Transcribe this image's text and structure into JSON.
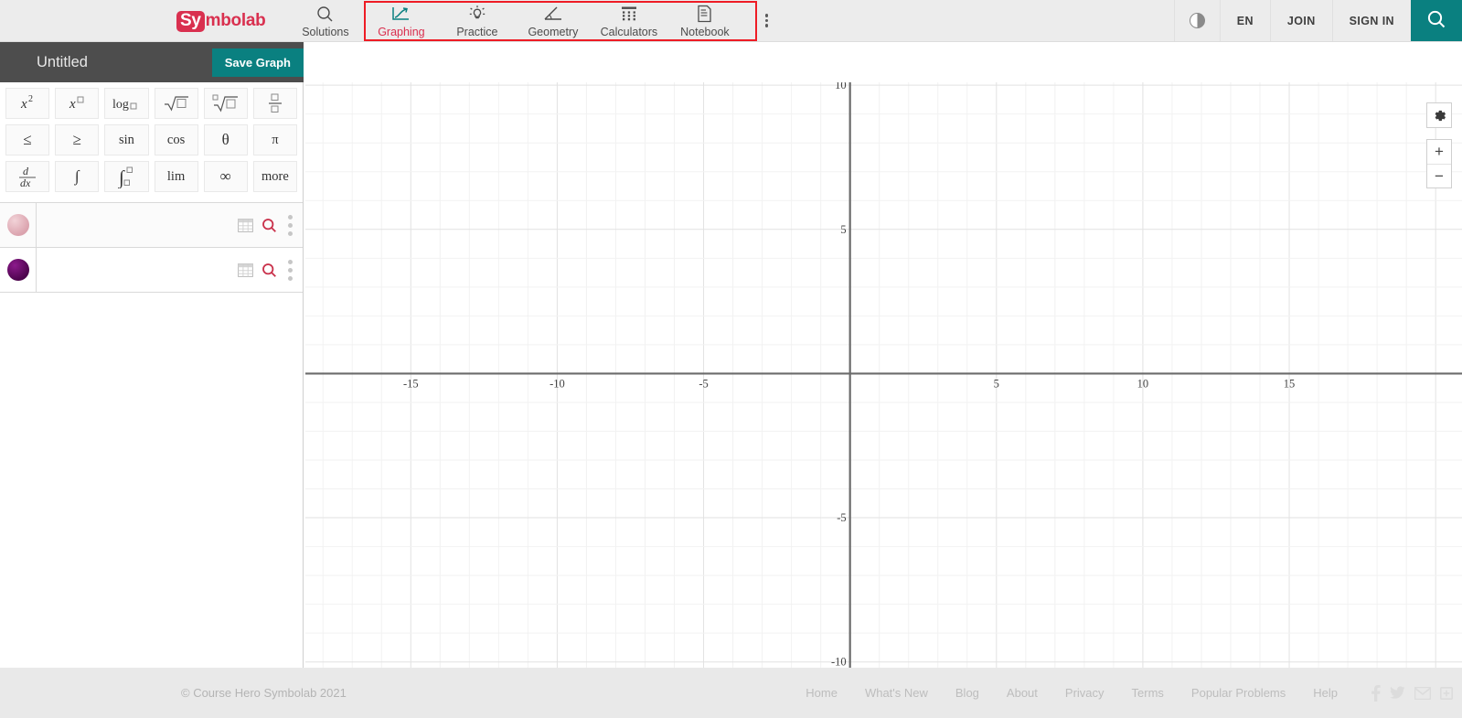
{
  "header": {
    "logo": {
      "badge": "Sy",
      "rest": "mbolab"
    },
    "nav": [
      {
        "label": "Solutions",
        "icon": "search-icon",
        "active": false
      },
      {
        "label": "Graphing",
        "icon": "graph-line-icon",
        "active": true
      },
      {
        "label": "Practice",
        "icon": "lightbulb-icon",
        "active": false
      },
      {
        "label": "Geometry",
        "icon": "angle-icon",
        "active": false
      },
      {
        "label": "Calculators",
        "icon": "grid-dots-icon",
        "active": false
      },
      {
        "label": "Notebook",
        "icon": "notebook-icon",
        "active": false
      }
    ],
    "overflow_icon": "vertical-dots-icon",
    "contrast_icon": "contrast-toggle-icon",
    "language": "EN",
    "join": "JOIN",
    "sign_in": "SIGN IN",
    "search_icon": "search-icon",
    "accent_teal": "#0a8080",
    "accent_red": "#d9304f",
    "highlight_box_color": "#ee1c25"
  },
  "titlebar": {
    "menu_icon": "vertical-dots-icon",
    "graph_name": "Untitled",
    "save_label": "Save Graph"
  },
  "keypad": [
    {
      "name": "x-squared",
      "type": "svg"
    },
    {
      "name": "x-power",
      "type": "svg"
    },
    {
      "name": "log-base",
      "type": "svg"
    },
    {
      "name": "square-root",
      "type": "svg"
    },
    {
      "name": "nth-root",
      "type": "svg"
    },
    {
      "name": "fraction",
      "type": "svg"
    },
    {
      "name": "less-than-equal",
      "text": "≤"
    },
    {
      "name": "greater-than-equal",
      "text": "≥"
    },
    {
      "name": "sin",
      "text": "sin"
    },
    {
      "name": "cos",
      "text": "cos"
    },
    {
      "name": "theta",
      "text": "θ"
    },
    {
      "name": "pi",
      "text": "π"
    },
    {
      "name": "derivative",
      "type": "svg"
    },
    {
      "name": "integral",
      "text": "∫"
    },
    {
      "name": "definite-integral",
      "type": "svg"
    },
    {
      "name": "limit",
      "text": "lim"
    },
    {
      "name": "infinity",
      "text": "∞"
    },
    {
      "name": "more",
      "text": "more"
    }
  ],
  "equations": [
    {
      "color": "#e0aab4",
      "value": "",
      "placeholder": "",
      "table_icon": "table-icon",
      "zoom_icon": "magnifier-icon",
      "menu_icon": "vertical-dots-icon"
    },
    {
      "color": "#5c0a5c",
      "value": "",
      "placeholder": "",
      "table_icon": "table-icon",
      "zoom_icon": "magnifier-icon",
      "menu_icon": "vertical-dots-icon"
    }
  ],
  "graph": {
    "settings_icon": "gear-icon",
    "zoom_in_label": "+",
    "zoom_out_label": "−",
    "grid_color": "#ececec",
    "axis_color": "#6b6b6b"
  },
  "chart_data": {
    "type": "line",
    "title": "",
    "xlabel": "",
    "ylabel": "",
    "xlim": [
      -18.6,
      20.9
    ],
    "ylim": [
      -10.2,
      10.1
    ],
    "x_ticks": [
      -15,
      -10,
      -5,
      5,
      10,
      15
    ],
    "y_ticks": [
      10,
      5,
      -5,
      -10
    ],
    "x_tick_labels": [
      "-15",
      "-10",
      "-5",
      "5",
      "10",
      "15"
    ],
    "y_tick_labels": [
      "10",
      "5",
      "-5",
      "-10"
    ],
    "grid": true,
    "minor_grid_step": 1,
    "major_grid_step": 5,
    "series": [],
    "legend": "none"
  },
  "footer": {
    "copyright": "© Course Hero Symbolab 2021",
    "links": [
      "Home",
      "What's New",
      "Blog",
      "About",
      "Privacy",
      "Terms",
      "Popular Problems",
      "Help"
    ],
    "social": [
      "facebook-icon",
      "twitter-icon",
      "email-icon",
      "share-icon"
    ]
  }
}
